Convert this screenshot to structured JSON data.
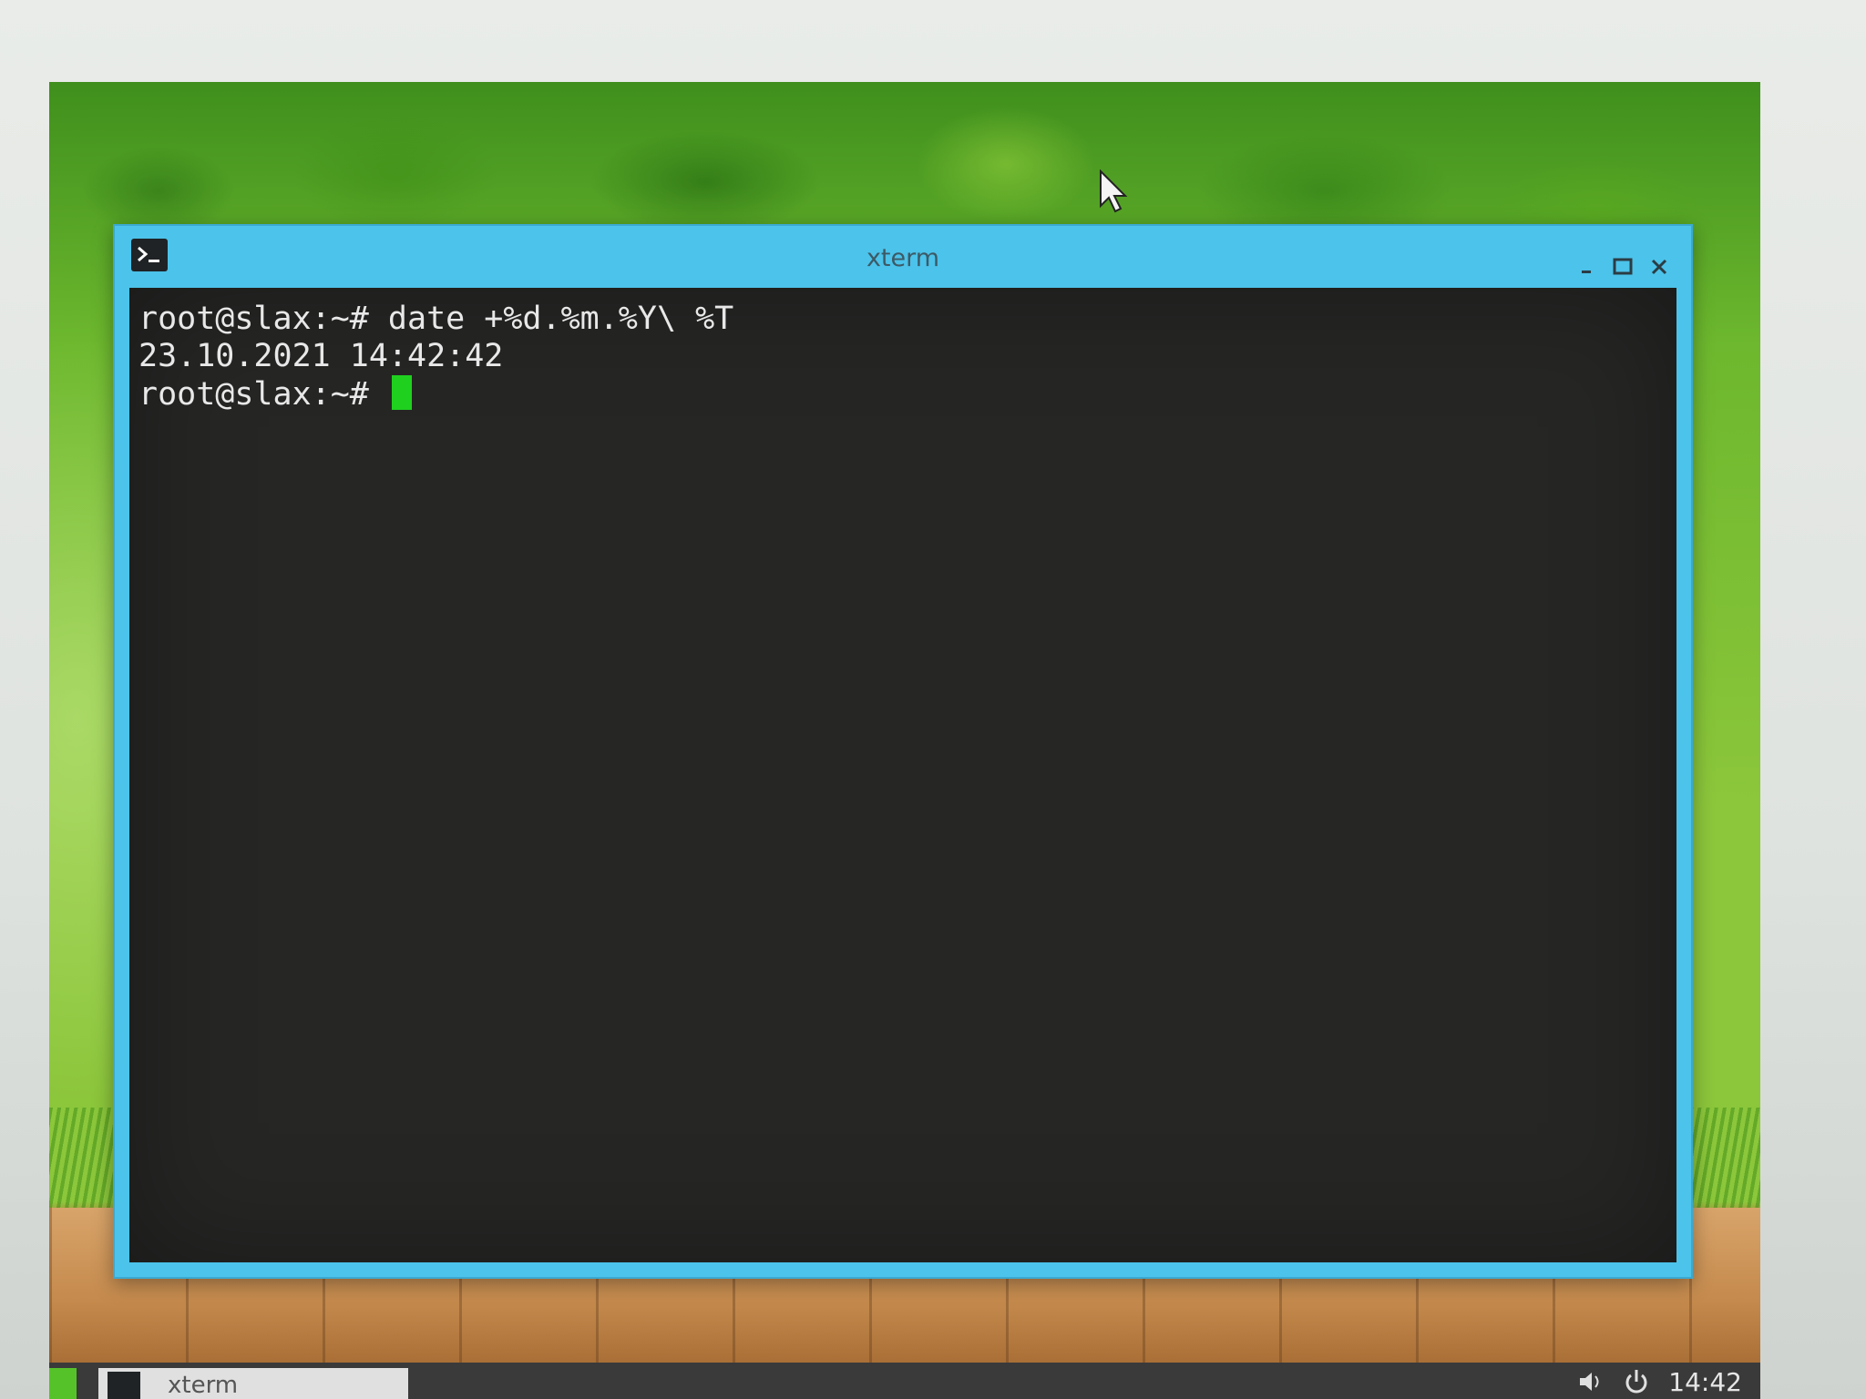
{
  "window": {
    "title": "xterm",
    "icons": {
      "app": "terminal-icon",
      "minimize": "minimize-icon",
      "maximize": "maximize-icon",
      "close": "close-icon"
    }
  },
  "terminal": {
    "lines": [
      "root@slax:~# date +%d.%m.%Y\\ %T",
      "23.10.2021 14:42:42",
      "root@slax:~# "
    ],
    "cursor_color": "#1fd01f"
  },
  "taskbar": {
    "task_label": "xterm",
    "clock": "14:42",
    "icons": [
      "volume-icon",
      "power-icon"
    ]
  },
  "colors": {
    "window_frame": "#4cc3ea",
    "terminal_bg": "#262725",
    "terminal_fg": "#e8e8e8"
  }
}
